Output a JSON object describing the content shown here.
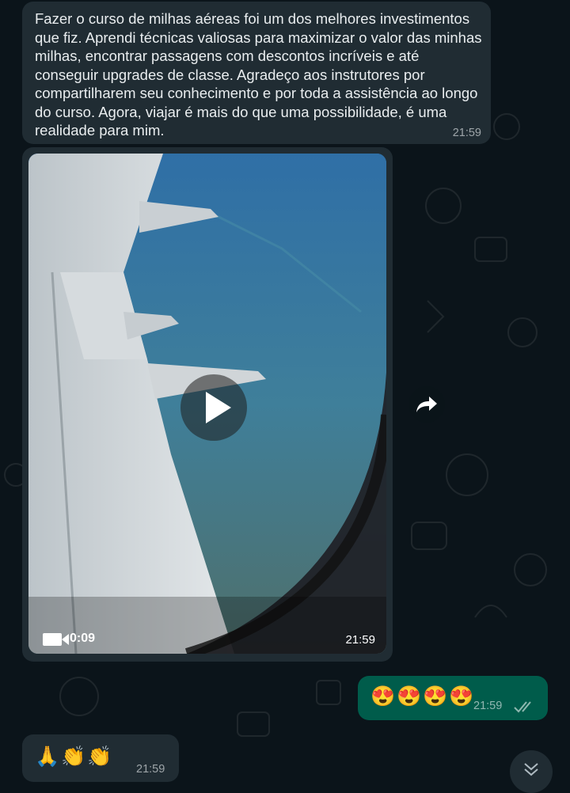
{
  "messages": [
    {
      "direction": "incoming",
      "text": "Fazer o curso de milhas aéreas foi um dos melhores investimentos que fiz. Aprendi técnicas valiosas para maximizar o valor das minhas milhas, encontrar passagens com descontos incríveis e até conseguir upgrades de classe. Agradeço aos instrutores por compartilharem seu conhecimento e por toda a assistência ao longo do curso. Agora, viajar é mais do que uma possibilidade, é uma realidade para mim.",
      "time": "21:59"
    },
    {
      "direction": "incoming",
      "type": "video",
      "duration": "0:09",
      "time": "21:59"
    },
    {
      "direction": "outgoing",
      "text": "😍😍😍😍",
      "time": "21:59",
      "status": "read-double-check"
    },
    {
      "direction": "incoming",
      "text": "🙏👏👏",
      "time": "21:59"
    }
  ],
  "colors": {
    "background": "#0b141a",
    "incoming_bubble": "#202c33",
    "outgoing_bubble": "#005c4b",
    "read_check": "#53bdeb"
  },
  "icons": {
    "play": "play-icon",
    "video_camera": "video-camera-icon",
    "forward": "forward-arrow-icon",
    "read_receipt": "double-check-icon",
    "scroll_down": "double-chevron-down-icon"
  }
}
